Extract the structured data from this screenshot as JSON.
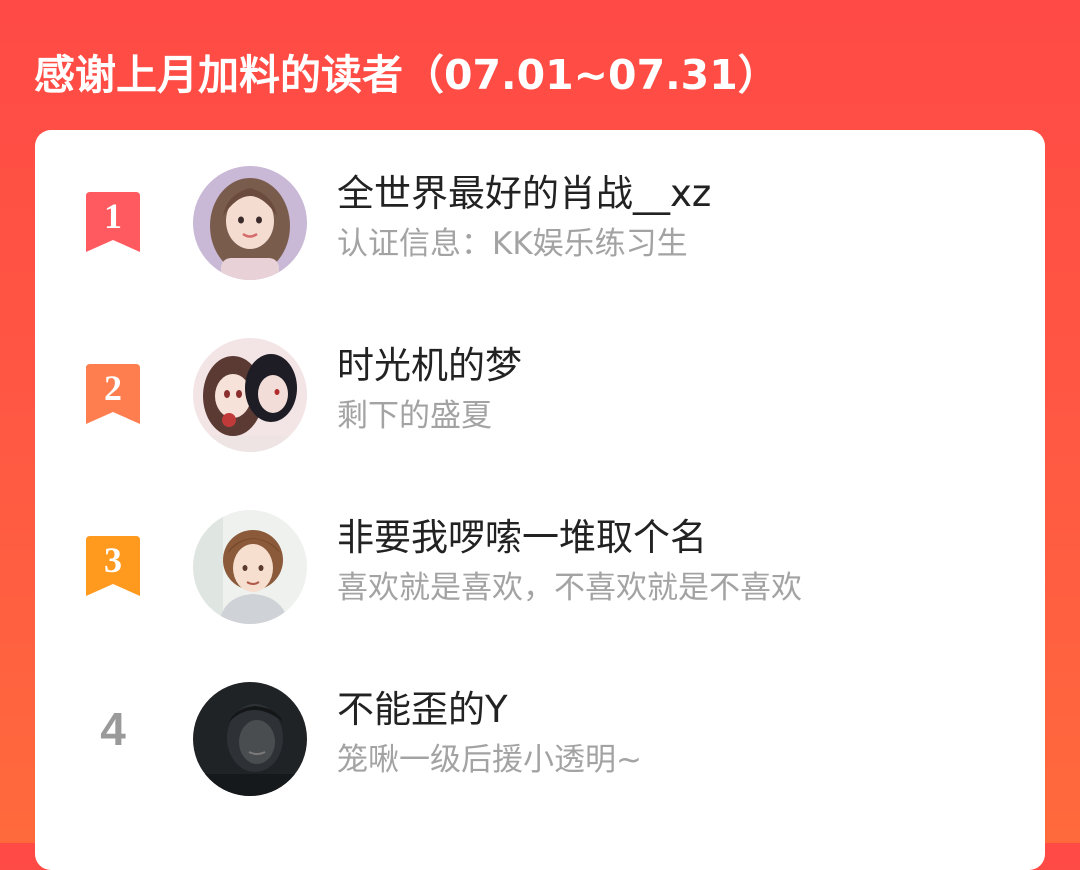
{
  "header": {
    "title": "感谢上月加料的读者（07.01~07.31）"
  },
  "readers": [
    {
      "rank": "1",
      "badge_color": "#ff5a5f",
      "avatar_icon": "avatar-girl-long-hair",
      "name": "全世界最好的肖战__xz",
      "subtitle": "认证信息：KK娱乐练习生"
    },
    {
      "rank": "2",
      "badge_color": "#ff7e4f",
      "avatar_icon": "avatar-anime-couple",
      "name": "时光机的梦",
      "subtitle": "剩下的盛夏"
    },
    {
      "rank": "3",
      "badge_color": "#ff9a1f",
      "avatar_icon": "avatar-anime-boy",
      "name": "非要我啰嗦一堆取个名",
      "subtitle": "喜欢就是喜欢，不喜欢就是不喜欢"
    },
    {
      "rank": "4",
      "badge_color": "#9a9a9a",
      "avatar_icon": "avatar-dark-photo",
      "name": "不能歪的Y",
      "subtitle": "笼啾一级后援小透明~"
    }
  ]
}
